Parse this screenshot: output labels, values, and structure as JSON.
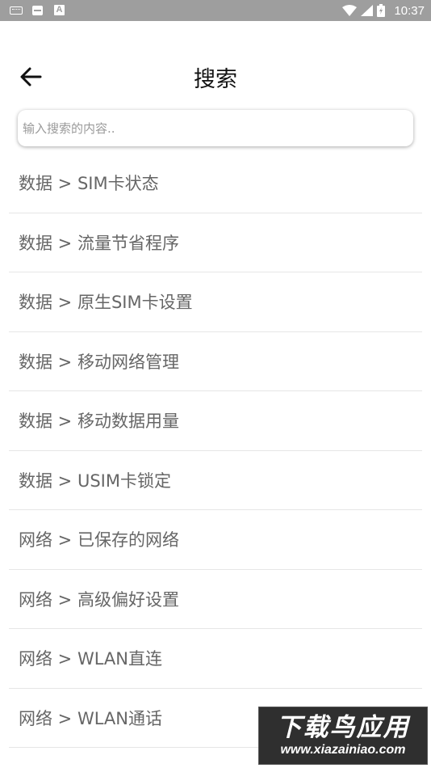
{
  "status_bar": {
    "time": "10:37",
    "left_icons": [
      "keyboard-icon",
      "message-icon",
      "a-icon"
    ],
    "a_icon_label": "A",
    "right_icons": [
      "wifi-icon",
      "signal-icon",
      "battery-icon"
    ]
  },
  "header": {
    "title": "搜索",
    "back_icon": "arrow-left-icon"
  },
  "search": {
    "placeholder": "输入搜索的内容.."
  },
  "results": [
    "数据 > SIM卡状态",
    "数据 > 流量节省程序",
    "数据 > 原生SIM卡设置",
    "数据 > 移动网络管理",
    "数据 > 移动数据用量",
    "数据 > USIM卡锁定",
    "网络 > 已保存的网络",
    "网络 > 高级偏好设置",
    "网络 > WLAN直连",
    "网络 > WLAN通话"
  ],
  "watermark": {
    "title": "下载鸟应用",
    "url": "www.xiazainiao.com"
  },
  "colors": {
    "status_bar_bg": "#9e9e9e",
    "title_text": "#111111",
    "item_text": "#666666",
    "divider": "#e6e6e6"
  }
}
